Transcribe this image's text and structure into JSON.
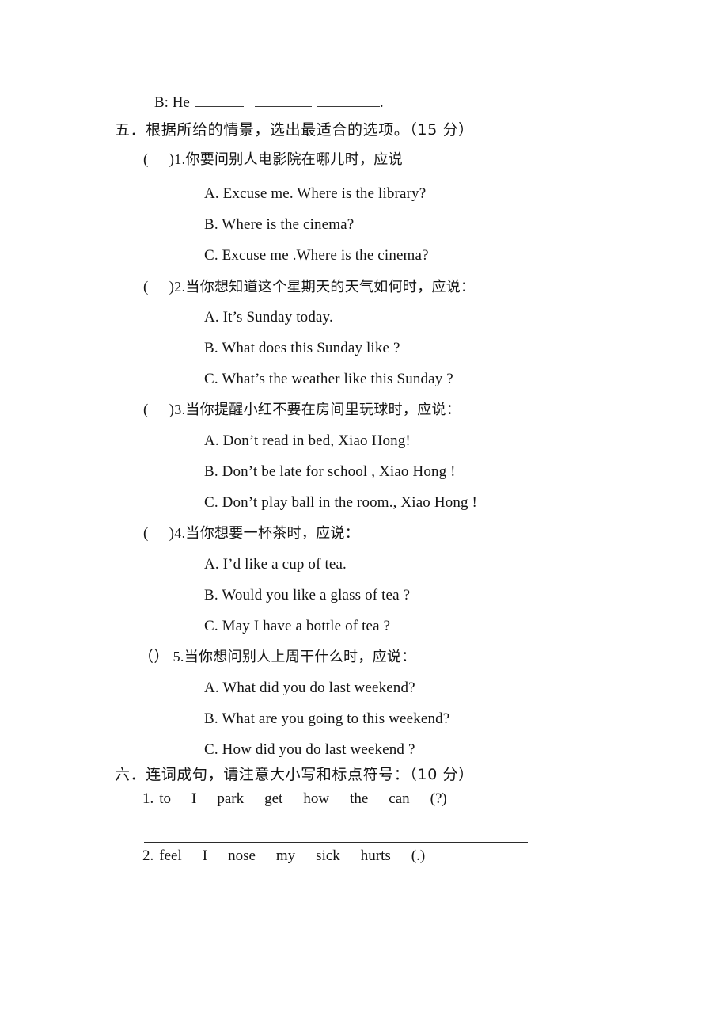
{
  "document": {
    "type": "printed-exam-paper",
    "language": "zh-CN + en"
  },
  "dialogue_tail": {
    "speaker_label": "B: He",
    "end_punctuation": "."
  },
  "section_five": {
    "heading": "五．根据所给的情景，选出最适合的选项。（15 分）",
    "questions": [
      {
        "bracket_open": "(",
        "bracket_close": ")",
        "number": "1.",
        "stem": "你要问别人电影院在哪儿时，应说",
        "options": [
          "A. Excuse me. Where is the library?",
          "B. Where is the cinema?",
          "C. Excuse me .Where is the cinema?"
        ]
      },
      {
        "bracket_open": "(",
        "bracket_close": ")",
        "number": "2.",
        "stem": "当你想知道这个星期天的天气如何时，应说：",
        "options": [
          "A. It’s Sunday today.",
          "B. What does this Sunday like ?",
          "C. What’s the weather like this Sunday ?"
        ]
      },
      {
        "bracket_open": "(",
        "bracket_close": ")",
        "number": "3.",
        "stem": "当你提醒小红不要在房间里玩球时，应说：",
        "options": [
          "A. Don’t read in bed, Xiao Hong!",
          "B. Don’t be late for school , Xiao Hong !",
          "C. Don’t play ball in the room., Xiao Hong !"
        ]
      },
      {
        "bracket_open": "(",
        "bracket_close": ")",
        "number": "4.",
        "stem": "当你想要一杯茶时，应说：",
        "options": [
          "A. I’d like a cup of tea.",
          "B. Would you like a glass of tea ?",
          "C. May I have a bottle of tea ?"
        ]
      },
      {
        "bracket_open": "（",
        "bracket_close": "）",
        "number": "5.",
        "stem": "当你想问别人上周干什么时，应说：",
        "options": [
          "A. What did you do last weekend?",
          "B. What are you going to this weekend?",
          "C. How did you do last weekend ?"
        ]
      }
    ]
  },
  "section_six": {
    "heading": "六．连词成句，请注意大小写和标点符号：（10 分）",
    "items": [
      {
        "number": "1.",
        "words": [
          "to",
          "I",
          "park",
          "get",
          "how",
          "the",
          "can",
          "(?)"
        ]
      },
      {
        "number": "2.",
        "words": [
          "feel",
          "I",
          "nose",
          "my",
          "sick",
          "hurts",
          "(.)"
        ]
      }
    ]
  },
  "colors": {
    "ink": "#141414",
    "paper": "#ffffff",
    "rule": "#2b2b2b"
  }
}
